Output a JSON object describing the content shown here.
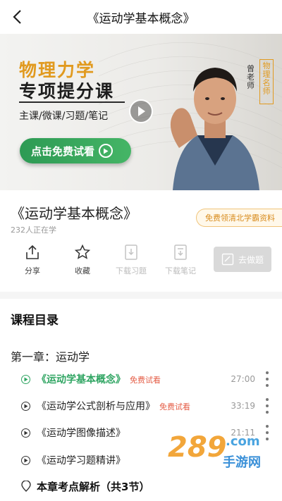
{
  "header": {
    "title": "《运动学基本概念》"
  },
  "video": {
    "headline1": "物理力学",
    "headline2": "专项提分课",
    "subtitle": "主课/微课/习题/笔记",
    "try_button": "点击免费试看",
    "teacher_name": "曾老师",
    "teacher_tag": "物理名师"
  },
  "course": {
    "title": "《运动学基本概念》",
    "learning": "232人正在学",
    "free_pill": "免费领清北学霸资料"
  },
  "actions": {
    "share": "分享",
    "favorite": "收藏",
    "download_exercise": "下载习题",
    "download_notes": "下载笔记",
    "go_exercise": "去做题"
  },
  "catalog": {
    "title": "课程目录",
    "chapter": "第一章：运动学",
    "lessons": [
      {
        "name": "《运动学基本概念》",
        "free": "免费试看",
        "time": "27:00"
      },
      {
        "name": "《运动学公式剖析与应用》",
        "free": "免费试看",
        "time": "33:19"
      },
      {
        "name": "《运动学图像描述》",
        "free": "",
        "time": "21:11"
      },
      {
        "name": "《运动学习题精讲》",
        "free": "",
        "time": ""
      },
      {
        "name": "本章考点解析（共3节）",
        "free": "",
        "time": ""
      }
    ]
  },
  "watermark": {
    "text1": "289",
    "text2": ".com",
    "text3": "手游网"
  }
}
